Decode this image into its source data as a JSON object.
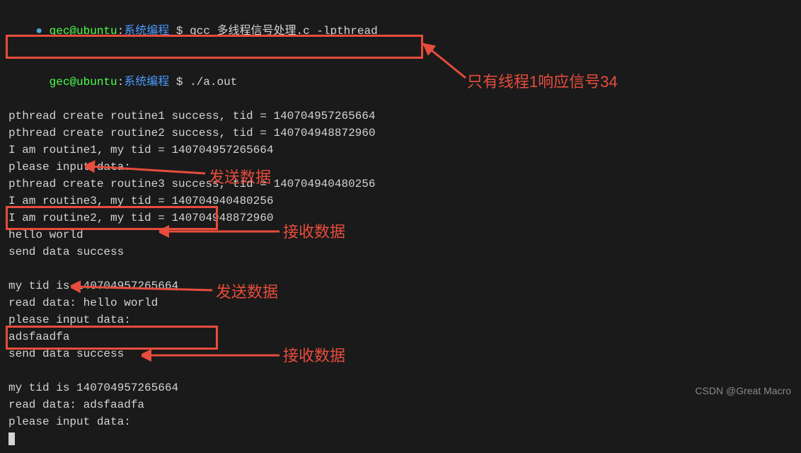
{
  "prompt1": {
    "bullet": "● ",
    "userHost": "gec@ubuntu",
    "cwd": "系统编程",
    "cmd": "gcc 多线程信号处理.c -lpthread"
  },
  "prompt2": {
    "bullet": "  ",
    "userHost": "gec@ubuntu",
    "cwd": "系统编程",
    "cmd": "./a.out"
  },
  "lines": {
    "l1": "pthread create routine1 success, tid = 140704957265664",
    "l2": "pthread create routine2 success, tid = 140704948872960",
    "l3": "I am routine1, my tid = 140704957265664",
    "l4": "please input data:",
    "l5": "pthread create routine3 success, tid = 140704940480256",
    "l6": "I am routine3, my tid = 140704940480256",
    "l7": "I am routine2, my tid = 140704948872960",
    "l8": "hello world",
    "l9": "send data success",
    "l10": " ",
    "l11": "my tid is 140704957265664",
    "l12": "read data: hello world",
    "l13": "please input data:",
    "l14": "adsfaadfa",
    "l15": "send data success",
    "l16": " ",
    "l17": "my tid is 140704957265664",
    "l18": "read data: adsfaadfa",
    "l19": "please input data:"
  },
  "annotations": {
    "a1": "只有线程1响应信号34",
    "a2": "发送数据",
    "a3": "接收数据",
    "a4": "发送数据",
    "a5": "接收数据"
  },
  "watermark": "CSDN @Great Macro"
}
